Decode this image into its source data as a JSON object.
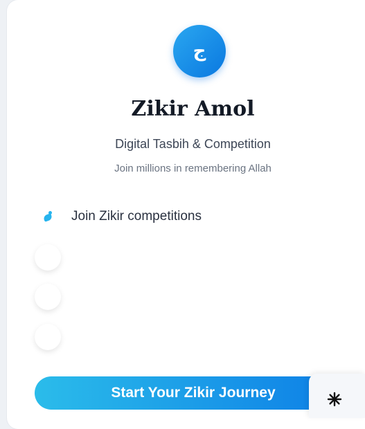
{
  "app": {
    "logo_glyph": "ج",
    "title": "Zikir Amol",
    "subtitle": "Digital Tasbih & Competition",
    "tagline": "Join millions in remembering Allah"
  },
  "features": [
    {
      "label": "Join Zikir competitions",
      "icon": "bird-icon"
    }
  ],
  "cta": {
    "label": "Start Your Zikir Journey"
  },
  "colors": {
    "accent_start": "#2bbcea",
    "accent_end": "#0c7de6",
    "title": "#131a26"
  }
}
